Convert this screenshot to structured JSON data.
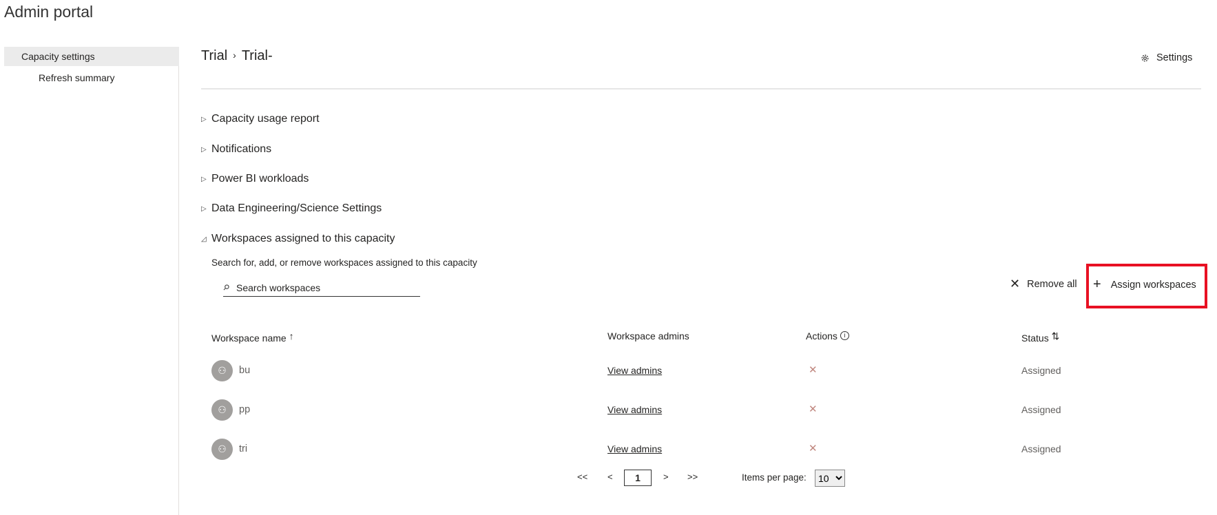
{
  "app": {
    "title": "Admin portal"
  },
  "sidebar": {
    "items": [
      {
        "label": "Capacity settings",
        "selected": true
      },
      {
        "label": "Refresh summary",
        "selected": false
      }
    ]
  },
  "breadcrumb": {
    "items": [
      "Trial",
      "Trial-"
    ],
    "separator": "›"
  },
  "header": {
    "settings_label": "Settings",
    "settings_icon": "gear-icon"
  },
  "sections": [
    {
      "label": "Capacity usage report",
      "expanded": false
    },
    {
      "label": "Notifications",
      "expanded": false
    },
    {
      "label": "Power BI workloads",
      "expanded": false
    },
    {
      "label": "Data Engineering/Science Settings",
      "expanded": false
    },
    {
      "label": "Workspaces assigned to this capacity",
      "expanded": true
    }
  ],
  "workspaces": {
    "description": "Search for, add, or remove workspaces assigned to this capacity",
    "search_placeholder": "Search workspaces",
    "remove_all_label": "Remove all",
    "assign_label": "Assign workspaces",
    "highlight_color": "#e81123",
    "columns": [
      "Workspace name",
      "Workspace admins",
      "Actions",
      "Status"
    ],
    "rows": [
      {
        "name": "bu",
        "admins": "View admins",
        "status": "Assigned"
      },
      {
        "name": "pp",
        "admins": "View admins",
        "status": "Assigned"
      },
      {
        "name": "tri",
        "admins": "View admins",
        "status": "Assigned"
      }
    ],
    "pagination": {
      "first": "<<",
      "prev": "<",
      "page": "1",
      "next": ">",
      "last": ">>",
      "items_per_page_label": "Items per page:",
      "items_per_page": "10"
    }
  }
}
